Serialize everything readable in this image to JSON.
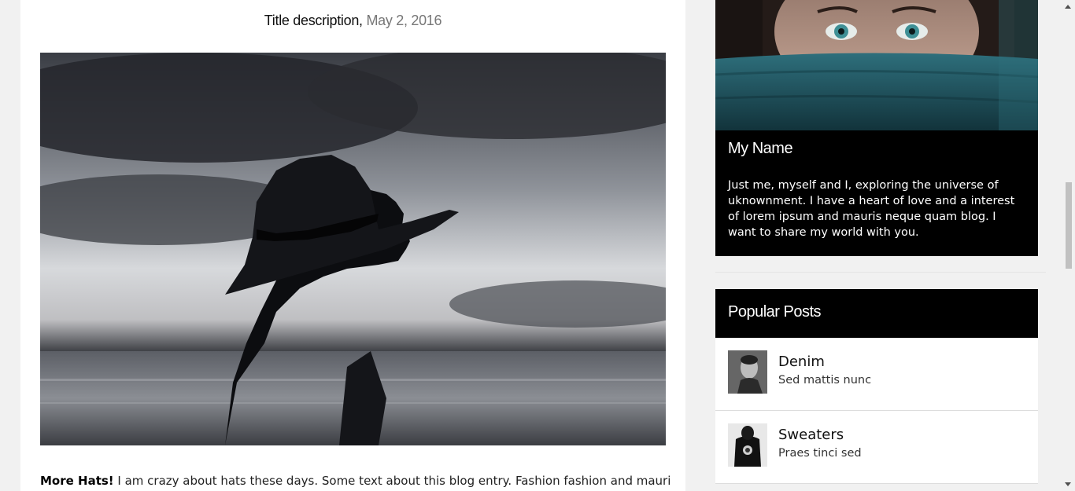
{
  "post": {
    "title": "Title description,",
    "date": "May 2, 2016",
    "body_bold": "More Hats!",
    "body_text": " I am crazy about hats these days. Some text about this blog entry. Fashion fashion and mauris neque"
  },
  "sidebar": {
    "profile": {
      "name": "My Name",
      "bio": "Just me, myself and I, exploring the universe of uknownment. I have a heart of love and a interest of lorem ipsum and mauris neque quam blog. I want to share my world with you."
    },
    "popular_posts": {
      "title": "Popular Posts",
      "items": [
        {
          "name": "Denim",
          "subtitle": "Sed mattis nunc"
        },
        {
          "name": "Sweaters",
          "subtitle": "Praes tinci sed"
        }
      ]
    }
  }
}
